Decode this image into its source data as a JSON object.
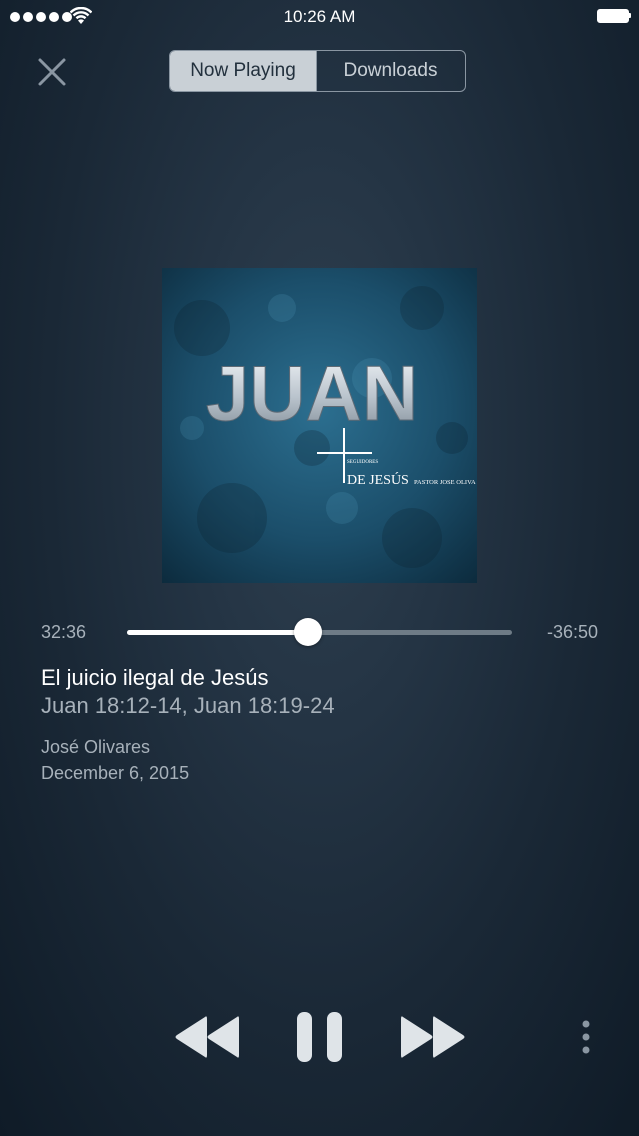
{
  "status_bar": {
    "time": "10:26 AM",
    "signal_bars": 5,
    "icons": [
      "signal-dots",
      "wifi-icon",
      "battery-icon"
    ]
  },
  "header": {
    "close_icon": "close-icon",
    "tabs": [
      {
        "label": "Now Playing",
        "selected": true
      },
      {
        "label": "Downloads",
        "selected": false
      }
    ]
  },
  "album": {
    "art_title": "JUAN",
    "art_caption_small": "SEGUIDORES",
    "art_caption": "DE JESÚS",
    "art_byline": "PASTOR JOSE OLIVA"
  },
  "player": {
    "elapsed": "32:36",
    "remaining": "-36:50",
    "progress_fraction": 0.47
  },
  "track": {
    "title": "El juicio ilegal de Jesús",
    "passage": "Juan 18:12-14, Juan 18:19-24",
    "speaker": "José Olivares",
    "date": "December 6, 2015"
  },
  "controls": {
    "icons": [
      "rewind-icon",
      "pause-icon",
      "fast-forward-icon",
      "more-icon"
    ]
  },
  "colors": {
    "accent": "#ffffff",
    "secondary_text": "#a7b1ba",
    "background": "#1a2836"
  }
}
